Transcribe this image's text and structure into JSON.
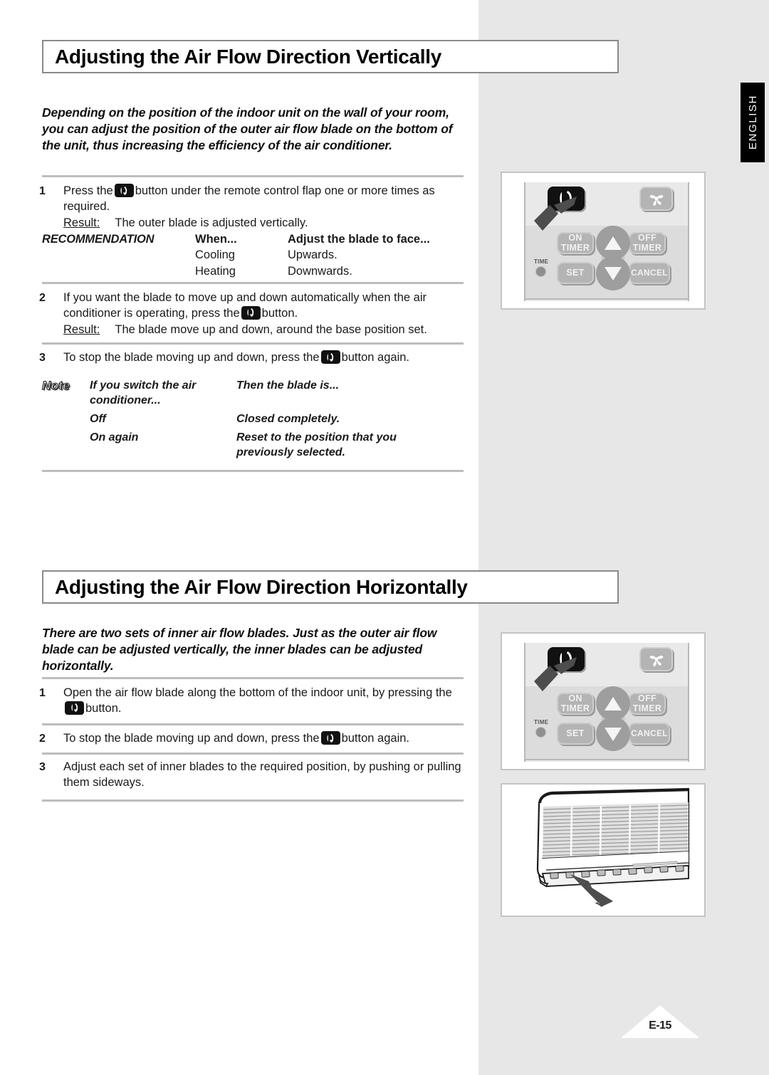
{
  "page": {
    "number": "E-15",
    "language_tab": "ENGLISH"
  },
  "sections": [
    {
      "heading": "Adjusting the Air Flow Direction Vertically",
      "intro": "Depending on the position of the indoor unit on the wall of your room, you can adjust the position of the outer air flow blade on the bottom of the unit, thus increasing the efficiency of the air conditioner.",
      "steps": [
        {
          "number": "1",
          "text_before_icon": "Press the",
          "icon": "swing-button-icon",
          "text_after_icon": "button under the remote control flap one or more times as required.",
          "result_label": "Result:",
          "result_text": "The outer blade is adjusted vertically."
        },
        {
          "number": "2",
          "text_before_icon": "If you want the blade to move up and down automatically when the air conditioner is operating, press the",
          "icon": "swing-button-icon",
          "text_after_icon": "button.",
          "result_label": "Result:",
          "result_text": "The blade move up and down, around the base position set."
        },
        {
          "number": "3",
          "text_before_icon": "To stop the blade moving up and down, press the",
          "icon": "swing-button-icon",
          "text_after_icon": "button again.",
          "result_label": "",
          "result_text": ""
        }
      ],
      "recommendation": {
        "label": "RECOMMENDATION",
        "headers": [
          "When...",
          "Adjust the blade to face..."
        ],
        "rows": [
          [
            "Cooling",
            "Upwards."
          ],
          [
            "Heating",
            "Downwards."
          ]
        ]
      },
      "note": {
        "badge": "Note",
        "headers": [
          "If you switch the air conditioner...",
          "Then the blade is..."
        ],
        "rows": [
          [
            "Off",
            "Closed completely."
          ],
          [
            "On again",
            "Reset to the position that you previously selected."
          ]
        ]
      }
    },
    {
      "heading": "Adjusting the Air Flow Direction Horizontally",
      "intro": "There are two sets of inner air flow blades. Just as the outer air flow blade can be adjusted vertically, the inner blades can be adjusted horizontally.",
      "steps": [
        {
          "number": "1",
          "text_before_icon": "Open the air flow blade along the bottom of the indoor unit, by pressing the",
          "icon": "swing-button-icon",
          "text_after_icon": "button."
        },
        {
          "number": "2",
          "text_before_icon": "To stop the blade moving up and down, press the",
          "icon": "swing-button-icon",
          "text_after_icon": "button again."
        },
        {
          "number": "3",
          "text_before_icon": "Adjust each set of inner blades to the required position, by pushing or pulling them sideways.",
          "icon": "",
          "text_after_icon": ""
        }
      ]
    }
  ],
  "remote": {
    "buttons": {
      "swing": "swing-blade-icon",
      "fan": "fan-icon",
      "on_timer": "ON\nTIMER",
      "on_timer_line1": "ON",
      "on_timer_line2": "TIMER",
      "off_timer_line1": "OFF",
      "off_timer_line2": "TIMER",
      "set": "SET",
      "cancel": "CANCEL",
      "arrow_up": "arrow-up-icon",
      "arrow_down": "arrow-down-icon"
    },
    "indicator": {
      "label": "TIME"
    }
  },
  "colors": {
    "page_white": "#ffffff",
    "page_gray": "#e7e7e7",
    "rule_gray": "#bdbdbd",
    "heading_border": "#8a8a8a",
    "button_gray": "#b4b4b4",
    "button_dark": "#111111",
    "tab_black": "#000000",
    "pointer_gray": "#4d4d4d"
  }
}
